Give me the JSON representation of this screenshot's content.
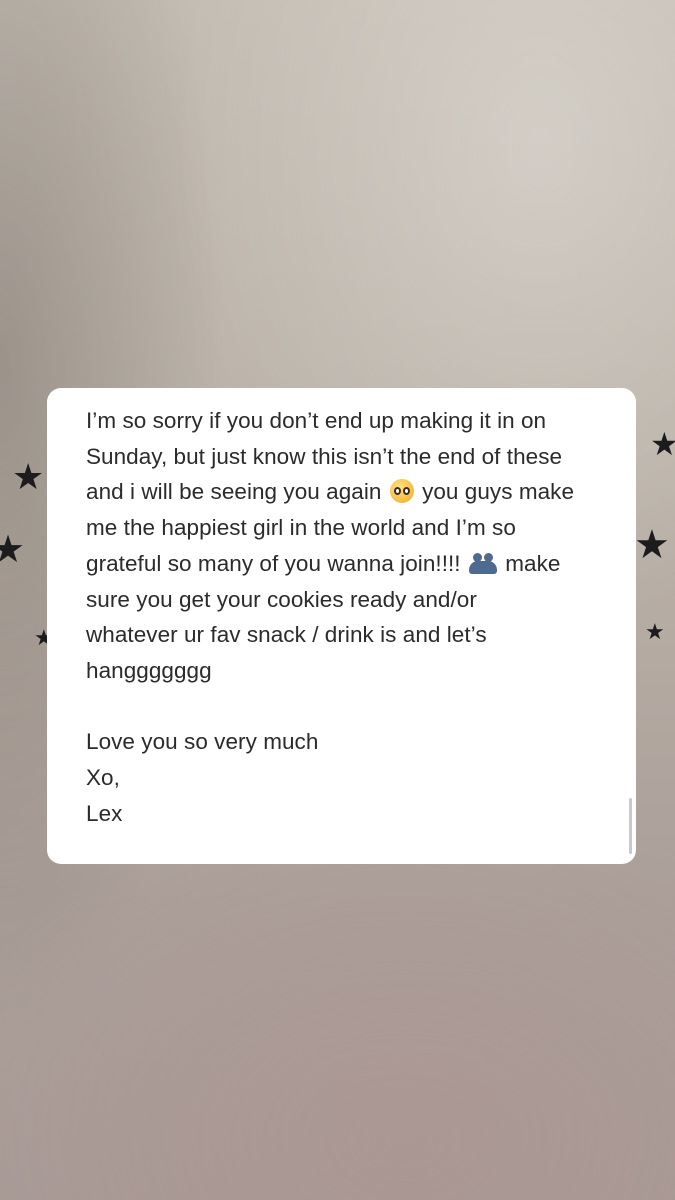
{
  "note": {
    "paragraph_lines": [
      "I’m so sorry if you don’t end up making it in on",
      "Sunday, but just know this isn’t the end of these",
      "and i will be seeing you again ",
      " you guys make",
      "me the happiest girl in the world and I’m so",
      "grateful so many of you wanna join!!!! ",
      " make",
      "sure you get your cookies ready and/or",
      "whatever ur fav snack / drink is and let’s",
      "hanggggggg"
    ],
    "closing_love": "Love you so very much",
    "closing_xo": "Xo,",
    "signature": "Lex"
  },
  "icons": {
    "emoji_1": "pleading-face-icon",
    "emoji_2": "people-hugging-icon",
    "background_decoration": "star-icon"
  },
  "colors": {
    "card_background": "#ffffff",
    "text": "#2b2b2d",
    "star": "#1c1c1e"
  }
}
